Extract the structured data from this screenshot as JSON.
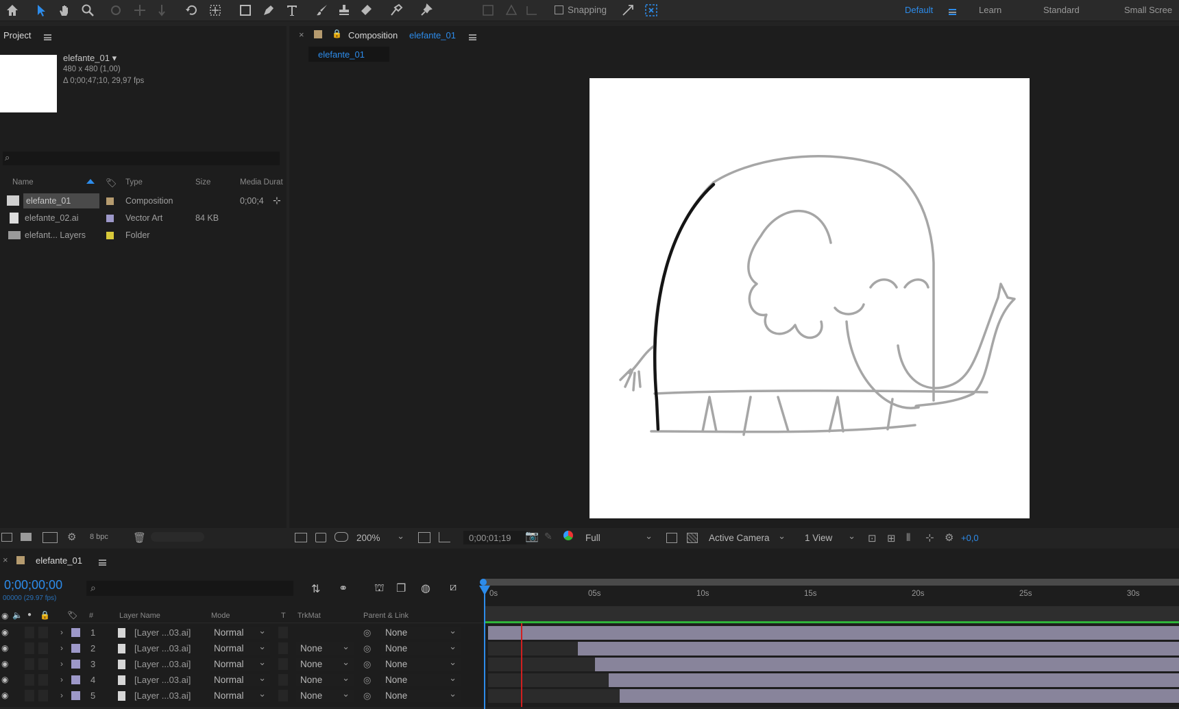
{
  "toolbar": {
    "snapping_label": "Snapping",
    "workspaces": [
      "Default",
      "Learn",
      "Standard",
      "Small Scree"
    ]
  },
  "project": {
    "tab_label": "Project",
    "comp_name": "elefante_01 ▾",
    "comp_dims": "480 x 480 (1,00)",
    "comp_duration": "Δ 0;00;47;10, 29,97 fps",
    "search_placeholder": "",
    "columns": [
      "Name",
      "Type",
      "Size",
      "Media Durat"
    ],
    "items": [
      {
        "name": "elefante_01",
        "type": "Composition",
        "size": "",
        "duration": "0;00;4",
        "color": "#b59b6f",
        "icon": "composition-icon"
      },
      {
        "name": "elefante_02.ai",
        "type": "Vector Art",
        "size": "84 KB",
        "duration": "",
        "color": "#9d98c9",
        "icon": "file-icon"
      },
      {
        "name": "elefant... Layers",
        "type": "Folder",
        "size": "",
        "duration": "",
        "color": "#d8c93a",
        "icon": "folder-icon"
      }
    ],
    "bpc_label": "8 bpc"
  },
  "composition": {
    "tab_prefix": "Composition",
    "tab_name": "elefante_01",
    "subtab": "elefante_01",
    "zoom": "200%",
    "timecode": "0;00;01;19",
    "resolution": "Full",
    "camera": "Active Camera",
    "views": "1 View",
    "exposure": "+0,0"
  },
  "timeline": {
    "tab_name": "elefante_01",
    "timecode": "0;00;00;00",
    "frame_info": "00000 (29.97 fps)",
    "ruler": [
      "0s",
      "05s",
      "10s",
      "15s",
      "20s",
      "25s",
      "30s"
    ],
    "columns": {
      "num": "#",
      "layer_name": "Layer Name",
      "mode": "Mode",
      "t": "T",
      "trkmat": "TrkMat",
      "parent": "Parent & Link"
    },
    "layers": [
      {
        "num": "1",
        "name": "[Layer ...03.ai]",
        "mode": "Normal",
        "trkmat": "",
        "parent": "None",
        "bar_start": 0.0
      },
      {
        "num": "2",
        "name": "[Layer ...03.ai]",
        "mode": "Normal",
        "trkmat": "None",
        "parent": "None",
        "bar_start": 0.13
      },
      {
        "num": "3",
        "name": "[Layer ...03.ai]",
        "mode": "Normal",
        "trkmat": "None",
        "parent": "None",
        "bar_start": 0.155
      },
      {
        "num": "4",
        "name": "[Layer ...03.ai]",
        "mode": "Normal",
        "trkmat": "None",
        "parent": "None",
        "bar_start": 0.175
      },
      {
        "num": "5",
        "name": "[Layer ...03.ai]",
        "mode": "Normal",
        "trkmat": "None",
        "parent": "None",
        "bar_start": 0.19
      }
    ]
  },
  "colors": {
    "accent": "#2d8ceb",
    "layer_label": "#9d98c9",
    "work_area": "#2fb53a",
    "layer_bar": "#88849b"
  }
}
